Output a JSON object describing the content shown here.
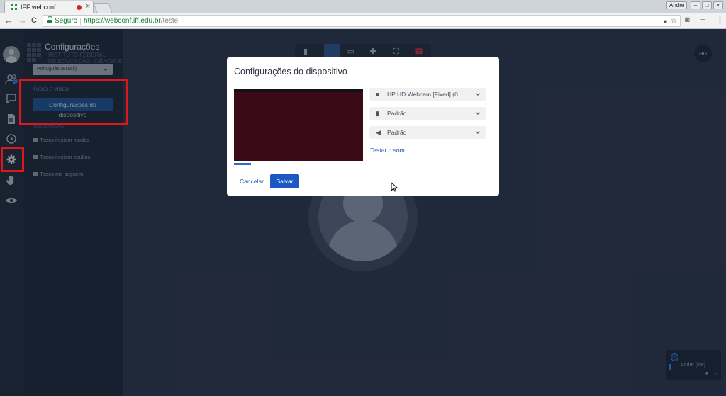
{
  "browser": {
    "tab_title": "IFF webconf",
    "tab_close": "×",
    "user_label": "André",
    "win_min": "–",
    "win_max": "□",
    "win_close": "×",
    "nav_back": "←",
    "nav_forward": "→",
    "nav_reload": "C",
    "secure_label": "Seguro",
    "url_host": "https://webconf.iff.edu.br",
    "url_path": "/teste",
    "menu_glyph": "⋮",
    "star_glyph": "☆"
  },
  "sidebar": {
    "badge_count": "1",
    "items": [
      {
        "name": "users-icon"
      },
      {
        "name": "chat-icon"
      },
      {
        "name": "notes-icon"
      },
      {
        "name": "play-icon"
      },
      {
        "name": "gear-icon"
      },
      {
        "name": "hand-icon"
      },
      {
        "name": "eye-icon"
      }
    ]
  },
  "panel": {
    "title": "Configurações",
    "institution_lines": [
      "INSTITUTO FEDERAL",
      "DE EDUCAÇÃO, CIÊNCIA E TECNOLOGIA"
    ],
    "language": "Português (Brasil)",
    "section_audio_video": "ÁUDIO E VÍDEO",
    "device_button_line1": "Configurações do",
    "device_button_line2": "dispositivo",
    "section_moderation": "MODERAÇÃO",
    "options": [
      "Todos iniciam mudos",
      "Todos iniciam ocultos",
      "Todos me seguem"
    ]
  },
  "main": {
    "hd_label": "HD",
    "tile_name": "Andre (me)"
  },
  "modal": {
    "title": "Configurações do dispositivo",
    "camera_value": "HP HD Webcam [Fixed] (0...",
    "mic_value": "Padrão",
    "speaker_value": "Padrão",
    "test_sound": "Testar o som",
    "cancel": "Cancelar",
    "save": "Salvar"
  },
  "colors": {
    "accent": "#1c58c4",
    "annotation": "#e0161b",
    "background": "#2a3346"
  }
}
